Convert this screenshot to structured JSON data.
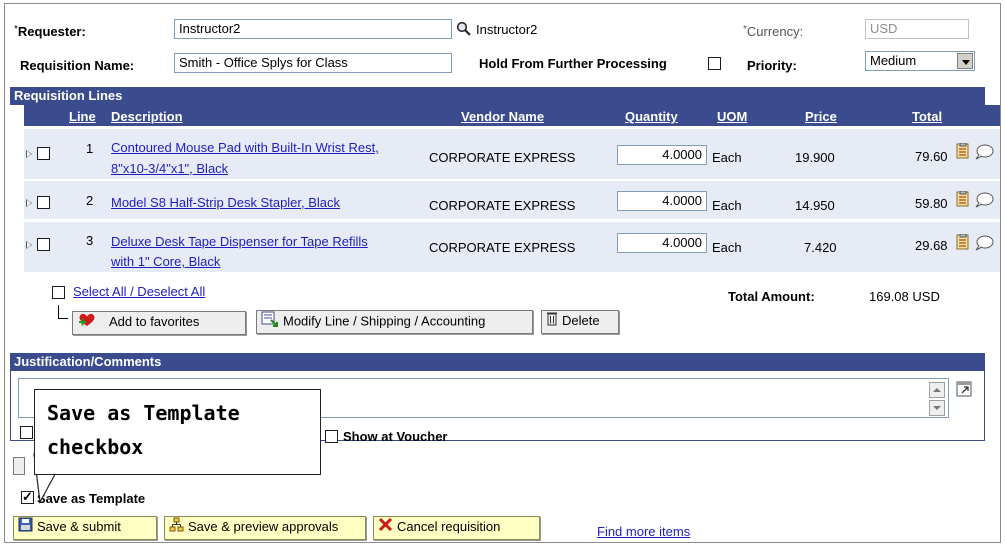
{
  "header": {
    "requester_label": "Requester:",
    "requester_required": "*",
    "requester_value": "Instructor2",
    "requester_display": "Instructor2",
    "currency_label": "Currency:",
    "currency_required": "*",
    "currency_value": "USD",
    "requisition_name_label": "Requisition Name:",
    "requisition_name_value": "Smith - Office Splys for Class",
    "hold_label": "Hold From Further Processing",
    "hold_checked": false,
    "priority_label": "Priority:",
    "priority_value": "Medium"
  },
  "lines_section": {
    "title": "Requisition Lines",
    "columns": {
      "line": "Line",
      "description": "Description",
      "vendor": "Vendor Name",
      "quantity": "Quantity",
      "uom": "UOM",
      "price": "Price",
      "total": "Total"
    },
    "rows": [
      {
        "line": "1",
        "desc1": "Contoured Mouse Pad with Built-In Wrist Rest,",
        "desc2": "8\"x10-3/4\"x1\", Black",
        "vendor": "CORPORATE EXPRESS",
        "quantity": "4.0000",
        "uom": "Each",
        "price": "19.900",
        "total": "79.60"
      },
      {
        "line": "2",
        "desc1": "Model S8 Half-Strip Desk Stapler, Black",
        "desc2": "",
        "vendor": "CORPORATE EXPRESS",
        "quantity": "4.0000",
        "uom": "Each",
        "price": "14.950",
        "total": "59.80"
      },
      {
        "line": "3",
        "desc1": "Deluxe Desk Tape Dispenser for Tape Refills",
        "desc2": "with 1\" Core, Black",
        "vendor": "CORPORATE EXPRESS",
        "quantity": "4.0000",
        "uom": "Each",
        "price": "7.420",
        "total": "29.68"
      }
    ],
    "select_all_label": "Select All / Deselect All",
    "total_amount_label": "Total Amount:",
    "total_amount_value": "169.08",
    "total_amount_currency": "USD",
    "add_favorites_label": "Add to favorites",
    "modify_label": "Modify Line / Shipping / Accounting",
    "delete_label": "Delete"
  },
  "comments_section": {
    "title": "Justification/Comments",
    "show_at_voucher_label": "Show at Voucher"
  },
  "save_as_template": {
    "label": "Save as Template",
    "checked": true
  },
  "callout": {
    "line1": "Save as Template",
    "line2": "checkbox"
  },
  "actions": {
    "save_submit": "Save & submit",
    "save_preview": "Save & preview approvals",
    "cancel": "Cancel requisition",
    "find_more": "Find more items"
  },
  "colors": {
    "section_header": "#3b4c8e",
    "row_background": "#e7ebf5",
    "link": "#1e1ebf",
    "action_button": "#ffffc4"
  }
}
